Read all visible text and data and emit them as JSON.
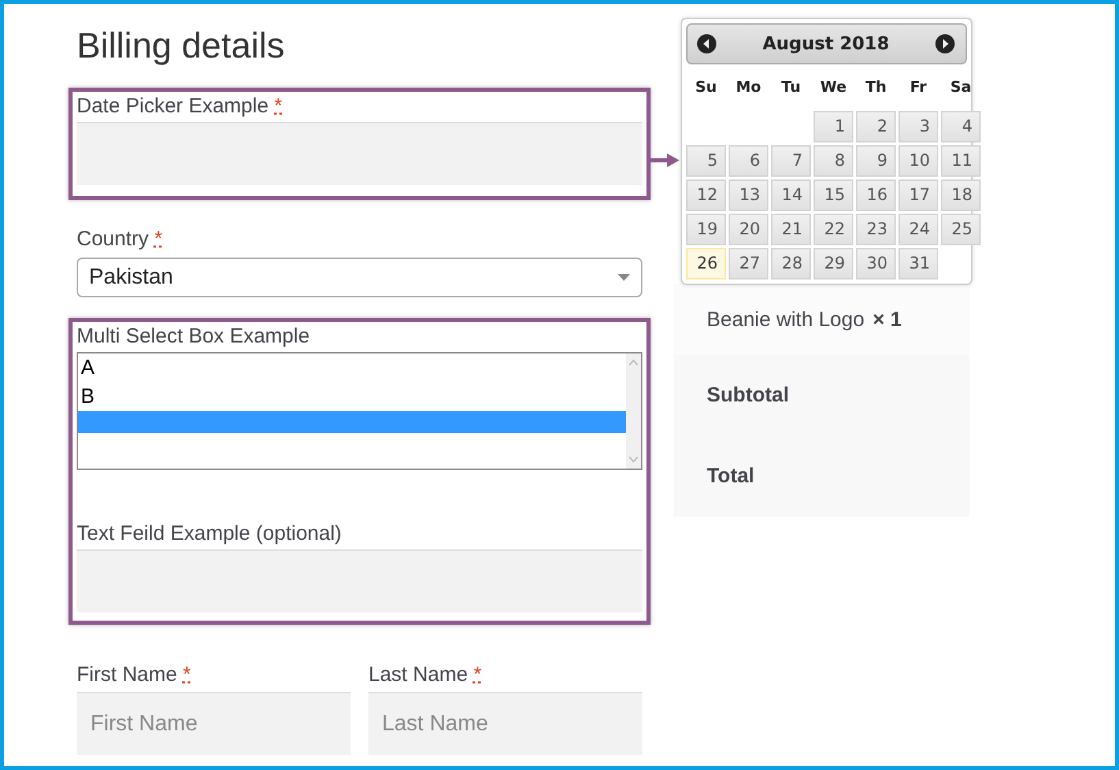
{
  "heading": "Billing details",
  "date_field": {
    "label": "Date Picker Example",
    "required": "*"
  },
  "country": {
    "label": "Country",
    "required": "*",
    "value": "Pakistan"
  },
  "multi_select": {
    "label": "Multi Select Box Example",
    "options": [
      {
        "label": "A",
        "selected": false
      },
      {
        "label": "B",
        "selected": false
      },
      {
        "selected": true
      }
    ]
  },
  "text_field": {
    "label": "Text Feild Example (optional)"
  },
  "name_fields": [
    {
      "label": "First Name",
      "required": "*",
      "placeholder": "First Name"
    },
    {
      "label": "Last Name",
      "required": "*",
      "placeholder": "Last Name"
    }
  ],
  "calendar": {
    "title": "August 2018",
    "weekdays": [
      "Su",
      "Mo",
      "Tu",
      "We",
      "Th",
      "Fr",
      "Sa"
    ],
    "weeks": [
      [
        {
          "d": "1",
          "today": false
        },
        {
          "d": "2",
          "today": false
        },
        {
          "d": "3",
          "today": false
        },
        {
          "d": "4",
          "today": false
        }
      ],
      [
        {
          "d": "5",
          "today": false
        },
        {
          "d": "6",
          "today": false
        },
        {
          "d": "7",
          "today": false
        },
        {
          "d": "8",
          "today": false
        },
        {
          "d": "9",
          "today": false
        },
        {
          "d": "10",
          "today": false
        },
        {
          "d": "11",
          "today": false
        }
      ],
      [
        {
          "d": "12",
          "today": false
        },
        {
          "d": "13",
          "today": false
        },
        {
          "d": "14",
          "today": false
        },
        {
          "d": "15",
          "today": false
        },
        {
          "d": "16",
          "today": false
        },
        {
          "d": "17",
          "today": false
        },
        {
          "d": "18",
          "today": false
        }
      ],
      [
        {
          "d": "19",
          "today": false
        },
        {
          "d": "20",
          "today": false
        },
        {
          "d": "21",
          "today": false
        },
        {
          "d": "22",
          "today": false
        },
        {
          "d": "23",
          "today": false
        },
        {
          "d": "24",
          "today": false
        },
        {
          "d": "25",
          "today": false
        }
      ],
      [
        {
          "d": "26",
          "today": true
        },
        {
          "d": "27",
          "today": false
        },
        {
          "d": "28",
          "today": false
        },
        {
          "d": "29",
          "today": false
        },
        {
          "d": "30",
          "today": false
        },
        {
          "d": "31",
          "today": false
        }
      ]
    ]
  },
  "order": {
    "item": "Beanie with Logo",
    "quantity": "× 1",
    "rows": [
      "Subtotal",
      "Total"
    ]
  }
}
